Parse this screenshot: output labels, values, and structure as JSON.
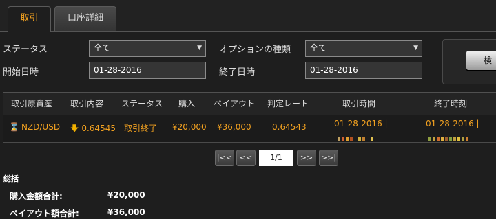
{
  "tabs": [
    {
      "label": "取引"
    },
    {
      "label": "口座詳細"
    }
  ],
  "filters": {
    "status_label": "ステータス",
    "status_value": "全て",
    "option_type_label": "オプションの種類",
    "option_type_value": "全て",
    "start_date_label": "開始日時",
    "start_date_value": "01-28-2016",
    "end_date_label": "終了日時",
    "end_date_value": "01-28-2016",
    "search_button": "検"
  },
  "table": {
    "headers": [
      "取引原資産",
      "取引内容",
      "ステータス",
      "購入",
      "ペイアウト",
      "判定レート",
      "取引時間",
      "終了時刻"
    ],
    "rows": [
      {
        "asset": "NZD/USD",
        "content": "0.64545",
        "status": "取引終了",
        "purchase": "¥20,000",
        "payout": "¥36,000",
        "rate": "0.64543",
        "trade_time": "01-28-2016 |",
        "end_time": "01-28-2016 |"
      }
    ]
  },
  "pager": {
    "first": "|<<",
    "prev": "<<",
    "page": "1/1",
    "next": ">>",
    "last": ">>|"
  },
  "summary": {
    "title": "総括",
    "purchase_total_label": "購入金額合計:",
    "purchase_total_value": "¥20,000",
    "payout_total_label": "ペイアウト額合計:",
    "payout_total_value": "¥36,000"
  },
  "colors": {
    "accent": "#f0a020",
    "background": "#1e1e1e"
  }
}
